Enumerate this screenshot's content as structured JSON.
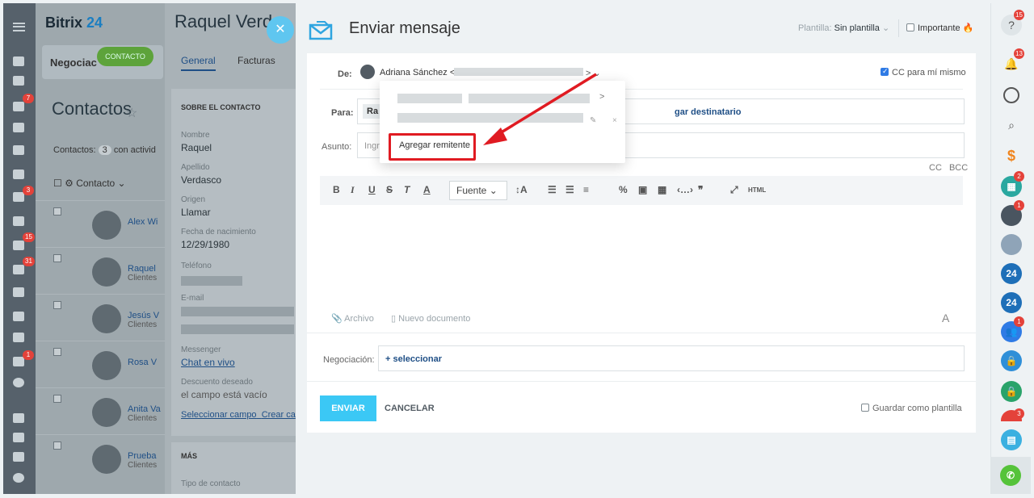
{
  "app": {
    "logo_main": "Bitrix",
    "logo_num": "24"
  },
  "leftbar": {
    "badges": [
      "7",
      "3",
      "15",
      "31",
      "1"
    ]
  },
  "crm": {
    "tab_label": "Negociac",
    "contact_pill": "CONTACTO",
    "title": "Contactos",
    "count_prefix": "Contactos:",
    "count_value": "3",
    "count_suffix": "con activid",
    "column_header": "Contacto ⌄",
    "rows": [
      {
        "name": "Alex Wi",
        "sub": ""
      },
      {
        "name": "Raquel",
        "sub": "Clientes"
      },
      {
        "name": "Jesús V",
        "sub": "Clientes"
      },
      {
        "name": "Rosa V",
        "sub": ""
      },
      {
        "name": "Anita Va",
        "sub": "Clientes"
      },
      {
        "name": "Prueba",
        "sub": "Clientes"
      }
    ]
  },
  "contact": {
    "name": "Raquel Verda",
    "tab_general": "General",
    "tab_facturas": "Facturas",
    "section_title": "SOBRE EL CONTACTO",
    "nombre_label": "Nombre",
    "nombre": "Raquel",
    "apellido_label": "Apellido",
    "apellido": "Verdasco",
    "origen_label": "Origen",
    "origen": "Llamar",
    "fecha_label": "Fecha de nacimiento",
    "fecha": "12/29/1980",
    "telefono_label": "Teléfono",
    "email_label": "E-mail",
    "messenger_label": "Messenger",
    "messenger": "Chat en vivo",
    "descuento_label": "Descuento deseado",
    "descuento": "el campo está vacío",
    "select_field": "Seleccionar campo",
    "create_field": "Crear ca",
    "mas": "MÁS",
    "tipo_label": "Tipo de contacto"
  },
  "modal": {
    "title": "Enviar mensaje",
    "template_label": "Plantilla:",
    "template_value": "Sin plantilla",
    "important_label": "Importante",
    "from_label": "De:",
    "from_name": "Adriana Sánchez <",
    "from_tail": "> ⌄",
    "cc_me": "CC para mí mismo",
    "to_label": "Para:",
    "to_chip": "Ra",
    "add_recipient": "gar destinatario",
    "subject_label": "Asunto:",
    "subject_placeholder": "Ingre",
    "cc": "CC",
    "bcc": "BCC",
    "font_select": "Fuente",
    "attach": "Archivo",
    "new_doc": "Nuevo documento",
    "deal_label": "Negociación:",
    "deal_select": "+ seleccionar",
    "send": "ENVIAR",
    "cancel": "CANCELAR",
    "save_template": "Guardar como plantilla"
  },
  "dropdown": {
    "gt": ">",
    "edit": "✎",
    "delete": "×",
    "add_sender": "Agregar remitente"
  },
  "rightbar": {
    "badges": [
      "15",
      "13",
      "2",
      "1",
      "1",
      "3"
    ],
    "labels_24": [
      "24",
      "24"
    ]
  },
  "colors": {
    "accent_blue": "#3bc8f5",
    "link_blue": "#1f4f86",
    "highlight_red": "#e01b22",
    "badge_red": "#e4423a"
  }
}
